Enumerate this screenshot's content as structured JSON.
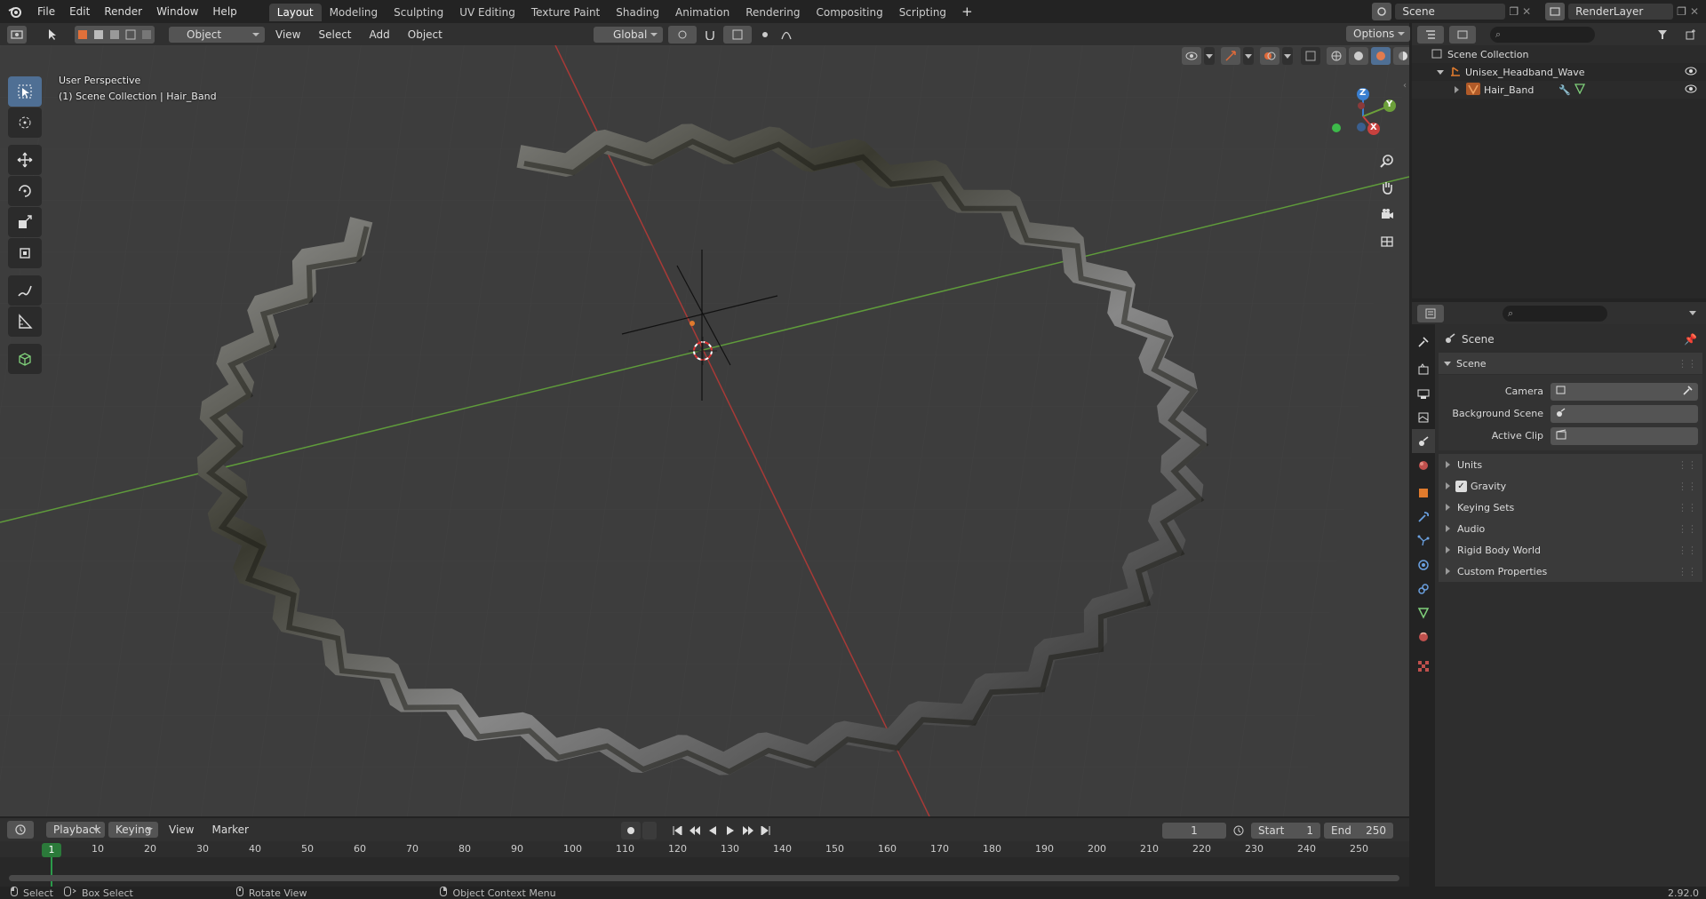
{
  "menu": {
    "file": "File",
    "edit": "Edit",
    "render": "Render",
    "window": "Window",
    "help": "Help"
  },
  "workspaces": [
    "Layout",
    "Modeling",
    "Sculpting",
    "UV Editing",
    "Texture Paint",
    "Shading",
    "Animation",
    "Rendering",
    "Compositing",
    "Scripting"
  ],
  "add_workspace": "+",
  "scene_selector": "Scene",
  "view_layer": "RenderLayer",
  "viewport_header": {
    "mode": "Object Mode",
    "view": "View",
    "select": "Select",
    "add": "Add",
    "object": "Object",
    "orientation": "Global",
    "options": "Options"
  },
  "overlay_text": {
    "perspective": "User Perspective",
    "collection": "(1) Scene Collection | Hair_Band"
  },
  "gizmo": {
    "x": "X",
    "y": "Y",
    "z": "Z"
  },
  "outliner": {
    "root": "Scene Collection",
    "collection": "Unisex_Headband_Wave",
    "object": "Hair_Band"
  },
  "properties": {
    "context": "Scene",
    "panel_scene": "Scene",
    "camera_label": "Camera",
    "background_scene_label": "Background Scene",
    "active_clip_label": "Active Clip",
    "units": "Units",
    "gravity": "Gravity",
    "keying_sets": "Keying Sets",
    "audio": "Audio",
    "rigid_body_world": "Rigid Body World",
    "custom_properties": "Custom Properties"
  },
  "timeline": {
    "playback": "Playback",
    "keying": "Keying",
    "view": "View",
    "marker": "Marker",
    "current_frame": "1",
    "start_label": "Start",
    "start": "1",
    "end_label": "End",
    "end": "250",
    "frame_marker": "1",
    "ticks": [
      "10",
      "20",
      "30",
      "40",
      "50",
      "60",
      "70",
      "80",
      "90",
      "100",
      "110",
      "120",
      "130",
      "140",
      "150",
      "160",
      "170",
      "180",
      "190",
      "200",
      "210",
      "220",
      "230",
      "240",
      "250"
    ]
  },
  "statusbar": {
    "select": "Select",
    "box_select": "Box Select",
    "rotate_view": "Rotate View",
    "context_menu": "Object Context Menu",
    "version": "2.92.0"
  },
  "colors": {
    "accent": "#4f6f94",
    "x_axis": "#c8413e",
    "y_axis": "#6ca03a",
    "z_axis": "#3a7fd0",
    "selected_orange": "#e07b2d"
  }
}
